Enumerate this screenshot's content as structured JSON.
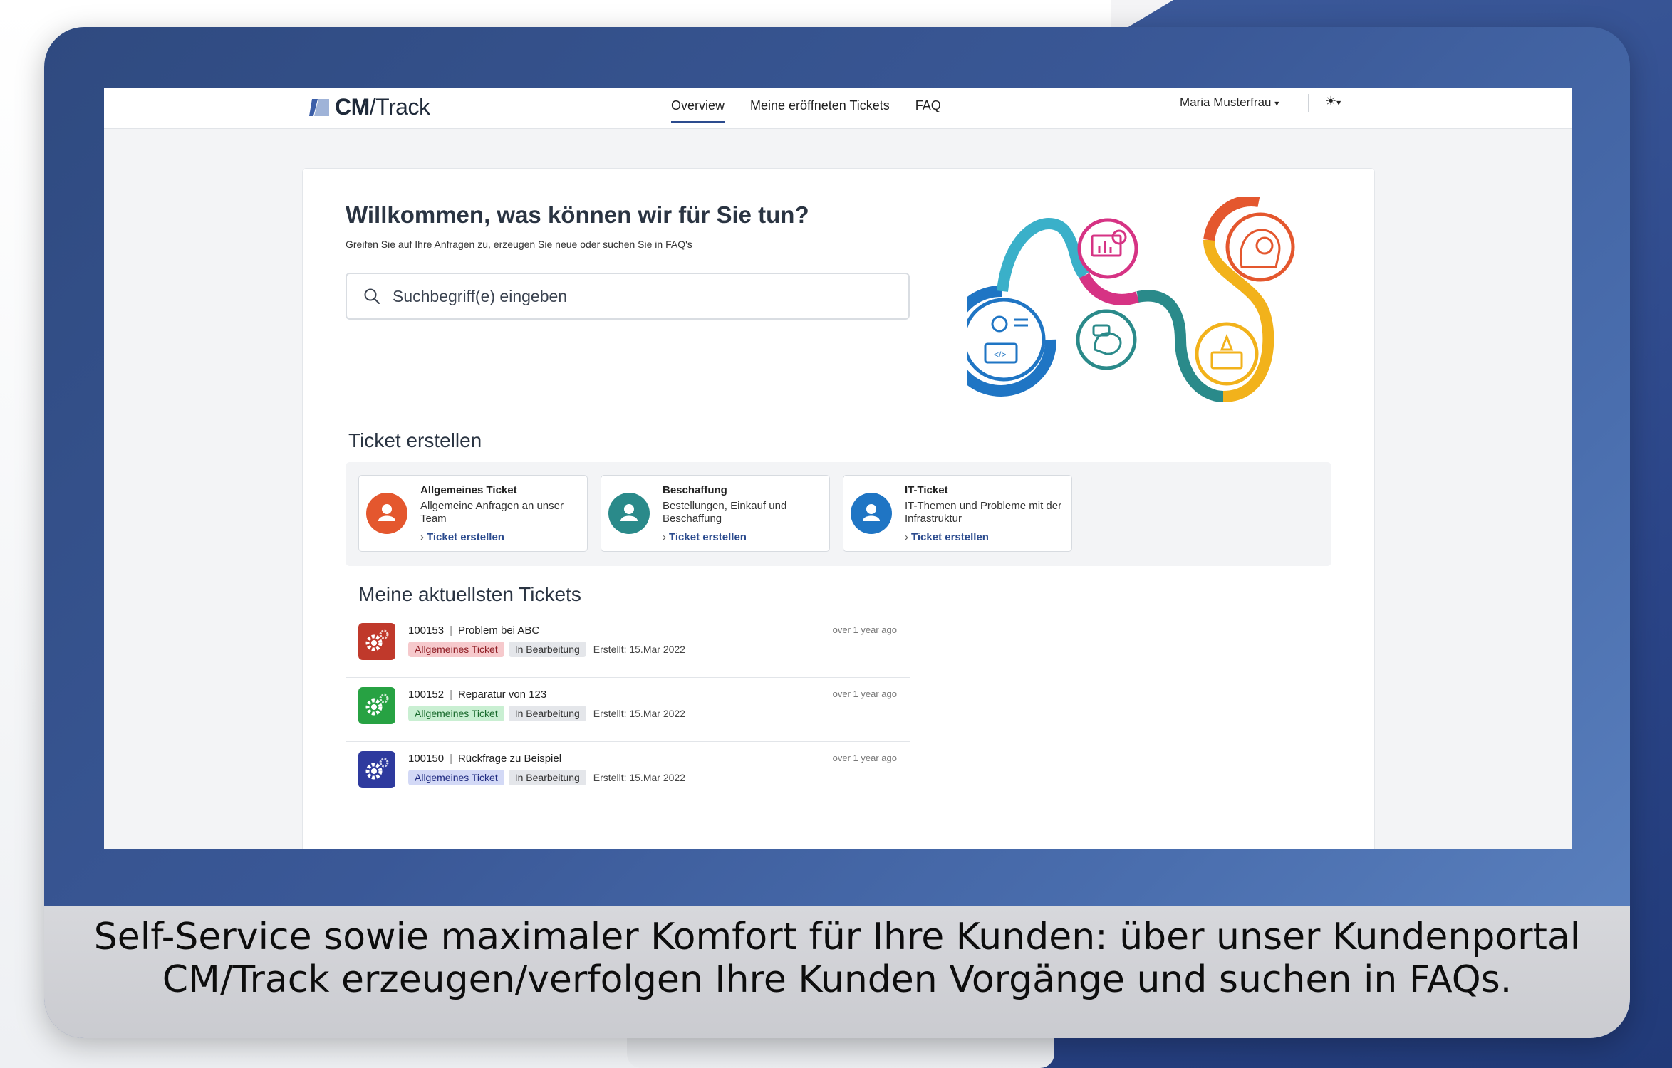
{
  "app": {
    "logo_bold": "CM",
    "logo_rest": "/Track"
  },
  "nav": {
    "items": [
      "Overview",
      "Meine eröffneten Tickets",
      "FAQ"
    ],
    "active": "Overview",
    "user": "Maria Musterfrau",
    "theme_icon": "sun-icon"
  },
  "welcome": {
    "title": "Willkommen, was können wir für Sie tun?",
    "subtitle": "Greifen Sie auf Ihre Anfragen zu, erzeugen Sie neue oder suchen Sie in FAQ's",
    "search_placeholder": "Suchbegriff(e) eingeben"
  },
  "create": {
    "heading": "Ticket erstellen",
    "cards": [
      {
        "title": "Allgemeines Ticket",
        "desc": "Allgemeine Anfragen an unser Team",
        "link": "Ticket erstellen",
        "color": "#e4572e"
      },
      {
        "title": "Beschaffung",
        "desc": "Bestellungen, Einkauf und Beschaffung",
        "link": "Ticket erstellen",
        "color": "#2a8a8a"
      },
      {
        "title": "IT-Ticket",
        "desc": "IT-Themen und Probleme mit der Infrastruktur",
        "link": "Ticket erstellen",
        "color": "#1f75c4"
      }
    ]
  },
  "recent": {
    "heading": "Meine aktuellsten Tickets",
    "tickets": [
      {
        "id": "100153",
        "subject": "Problem bei ABC",
        "type": "Allgemeines Ticket",
        "status": "In Bearbeitung",
        "created": "Erstellt: 15.Mar 2022",
        "time": "over 1 year ago",
        "icon_color": "#c0392b",
        "badge_bg": "#f6c9cc",
        "badge_fg": "#8f1d24"
      },
      {
        "id": "100152",
        "subject": "Reparatur von 123",
        "type": "Allgemeines Ticket",
        "status": "In Bearbeitung",
        "created": "Erstellt: 15.Mar 2022",
        "time": "over 1 year ago",
        "icon_color": "#27a243",
        "badge_bg": "#c9efd2",
        "badge_fg": "#17692b"
      },
      {
        "id": "100150",
        "subject": "Rückfrage zu Beispiel",
        "type": "Allgemeines Ticket",
        "status": "In Bearbeitung",
        "created": "Erstellt: 15.Mar 2022",
        "time": "over 1 year ago",
        "icon_color": "#2e3a9e",
        "badge_bg": "#d3d9f6",
        "badge_fg": "#1f2a80"
      }
    ]
  },
  "caption": {
    "line1": "Self-Service sowie maximaler Komfort für Ihre Kunden: über unser Kundenportal",
    "line2": "CM/Track erzeugen/verfolgen Ihre Kunden Vorgänge und suchen in FAQs."
  },
  "colors": {
    "accent": "#2b4b8e",
    "frame": "#3a5897"
  }
}
